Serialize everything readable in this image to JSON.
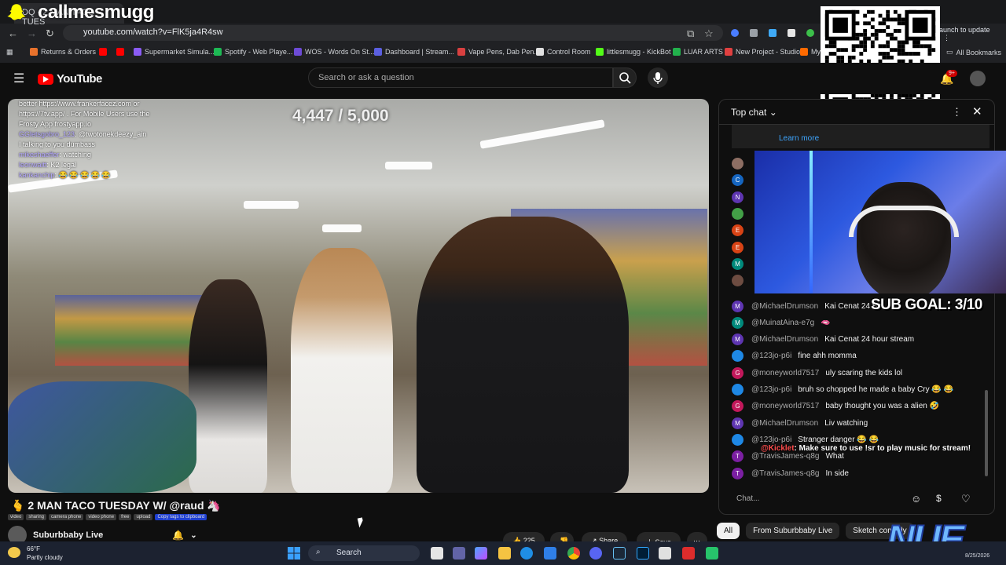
{
  "browser": {
    "tab_title": "DQ - 2 MAN TACO TUES",
    "url": "youtube.com/watch?v=FlK5ja4R4sw",
    "update_button": "Launch to update",
    "all_bookmarks": "All Bookmarks",
    "bookmarks": [
      {
        "label": "Returns & Orders",
        "color": "#e8722c"
      },
      {
        "label": "",
        "color": "#ff0000"
      },
      {
        "label": "",
        "color": "#ff0000"
      },
      {
        "label": "Supermarket Simula...",
        "color": "#8b5cf6"
      },
      {
        "label": "Spotify - Web Playe...",
        "color": "#1db954"
      },
      {
        "label": "WOS - Words On St...",
        "color": "#6d4bd6"
      },
      {
        "label": "Dashboard | Stream...",
        "color": "#5b5fe0"
      },
      {
        "label": "Vape Pens, Dab Pen...",
        "color": "#d94040"
      },
      {
        "label": "Control Room",
        "color": "#e0e0e0"
      },
      {
        "label": "littlesmugg - KickBot",
        "color": "#53fc18"
      },
      {
        "label": "LUAR ARTS",
        "color": "#22b14c"
      },
      {
        "label": "New Project - Studio",
        "color": "#e04040"
      },
      {
        "label": "My",
        "color": "#ff6a00"
      }
    ]
  },
  "overlay": {
    "streamer_name": "callmesmugg",
    "counter": "4,447 / 5,000",
    "sub_goal": "SUB GOAL: 3/10",
    "bot_user": "@Kicklet",
    "bot_message": ": Make sure to use !sr to play music for stream!",
    "logo": "NUE",
    "chat_lines": [
      {
        "user": "",
        "text": "better https://www.frankerfacez.com or"
      },
      {
        "user": "",
        "text": "https://7tv.app/ . For Mobile Users use the"
      },
      {
        "user": "",
        "text": "Frosty App frostyapp.io"
      },
      {
        "user": "GGletsgobro_123",
        "text": ": @twotonekdeezy_ain"
      },
      {
        "user": "",
        "text": "I talking to you dumbass"
      },
      {
        "user": "mikeshaeffer",
        "text": ": watching"
      },
      {
        "user": "leonwaitt",
        "text": ": K2 legal"
      },
      {
        "user": "kankanchip",
        "text": ": 😂 😂 😂 😂 😂"
      }
    ]
  },
  "youtube": {
    "logo_text": "YouTube",
    "search_placeholder": "Search or ask a question",
    "notification_count": "9+",
    "video_title": "🫰 2 MAN TACO TUESDAY W/ @raud 🦄",
    "tags": [
      "video",
      "sharing",
      "camera phone",
      "video phone",
      "free",
      "upload"
    ],
    "copy_tags_label": "Copy tags to clipboard",
    "channel_name": "Suburbbaby Live",
    "like_count": "225",
    "share_label": "Share",
    "save_label": "Save",
    "chat": {
      "header": "Top chat",
      "learn_more": "Learn more",
      "input_placeholder": "Chat...",
      "messages": [
        {
          "author": "@MichaelDrumson",
          "text": "Kai Cenat 24 Ho",
          "initial": "M",
          "color": "#5e35b1"
        },
        {
          "author": "@MuinatAina-e7g",
          "text": "🫦",
          "initial": "M",
          "color": "#00897b"
        },
        {
          "author": "@MichaelDrumson",
          "text": "Kai Cenat 24 hour stream",
          "initial": "M",
          "color": "#5e35b1"
        },
        {
          "author": "@123jo-p6i",
          "text": "fine ahh momma",
          "initial": "",
          "color": "#1e88e5"
        },
        {
          "author": "@moneyworld7517",
          "text": "uly scaring the kids lol",
          "initial": "G",
          "color": "#c2185b"
        },
        {
          "author": "@123jo-p6i",
          "text": "bruh so chopped he made a baby Cry 😂 😂",
          "initial": "",
          "color": "#1e88e5"
        },
        {
          "author": "@moneyworld7517",
          "text": "baby thought you was a alien 🤣",
          "initial": "G",
          "color": "#c2185b"
        },
        {
          "author": "@MichaelDrumson",
          "text": "Liv watching",
          "initial": "M",
          "color": "#5e35b1"
        },
        {
          "author": "@123jo-p6i",
          "text": "Stranger danger 😂 😂",
          "initial": "",
          "color": "#1e88e5"
        },
        {
          "author": "@TravisJames-q8g",
          "text": "What",
          "initial": "T",
          "color": "#7b1fa2"
        },
        {
          "author": "@TravisJames-q8g",
          "text": "In side",
          "initial": "T",
          "color": "#7b1fa2"
        }
      ],
      "hidden_avatars": [
        {
          "initial": "",
          "color": "#8d6e63"
        },
        {
          "initial": "C",
          "color": "#1565c0"
        },
        {
          "initial": "N",
          "color": "#5e35b1"
        },
        {
          "initial": "",
          "color": "#43a047"
        },
        {
          "initial": "E",
          "color": "#d84315"
        },
        {
          "initial": "E",
          "color": "#d84315"
        },
        {
          "initial": "M",
          "color": "#00897b"
        },
        {
          "initial": "",
          "color": "#6d4c41"
        }
      ]
    },
    "chips": [
      "All",
      "From Suburbbaby Live",
      "Sketch comedy"
    ]
  },
  "taskbar": {
    "temperature": "66°F",
    "condition": "Partly cloudy",
    "search_label": "Search",
    "date": "8/25/2026"
  }
}
